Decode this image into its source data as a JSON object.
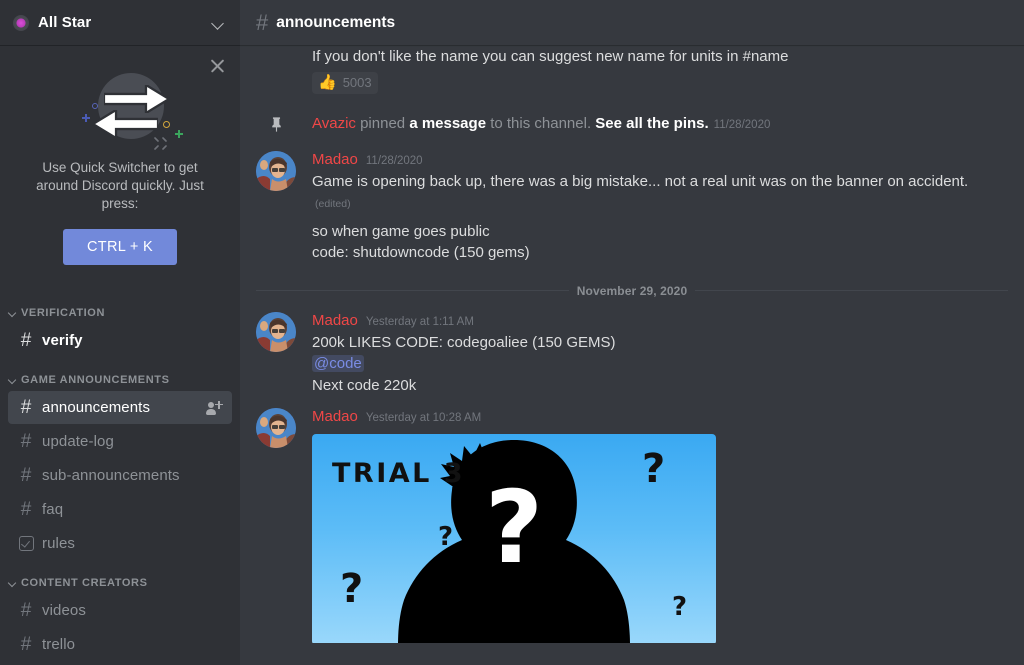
{
  "server": {
    "name": "All Star",
    "icon": "server-badge-icon",
    "dropdown_icon": "chevron-down-icon"
  },
  "promo": {
    "close_icon": "close-icon",
    "art_icon": "quick-switcher-arrows-icon",
    "text": "Use Quick Switcher to get around Discord quickly. Just press:",
    "shortcut_label": "CTRL + K",
    "accent_color": "#7289da"
  },
  "sidebar": {
    "categories": [
      {
        "label": "VERIFICATION",
        "channels": [
          {
            "name": "verify",
            "icon": "hash-icon",
            "state": "unread",
            "trailing_icon": null
          }
        ]
      },
      {
        "label": "GAME ANNOUNCEMENTS",
        "channels": [
          {
            "name": "announcements",
            "icon": "hash-icon",
            "state": "active",
            "trailing_icon": "invite-member-icon"
          },
          {
            "name": "update-log",
            "icon": "hash-icon",
            "state": "default",
            "trailing_icon": null
          },
          {
            "name": "sub-announcements",
            "icon": "hash-icon",
            "state": "default",
            "trailing_icon": null
          },
          {
            "name": "faq",
            "icon": "hash-icon",
            "state": "default",
            "trailing_icon": null
          },
          {
            "name": "rules",
            "icon": "rules-checkbox-icon",
            "state": "default",
            "trailing_icon": null
          }
        ]
      },
      {
        "label": "CONTENT CREATORS",
        "channels": [
          {
            "name": "videos",
            "icon": "hash-icon",
            "state": "default",
            "trailing_icon": null
          },
          {
            "name": "trello",
            "icon": "hash-icon",
            "state": "default",
            "trailing_icon": null
          }
        ]
      }
    ]
  },
  "channel_header": {
    "hash": "#",
    "name": "announcements"
  },
  "messages": {
    "partial_top": {
      "text": "If you don't like the name you can suggest new name for units in #name",
      "reaction": {
        "emoji": "👍",
        "emoji_name": "thumbs-up-emoji",
        "count": "5003"
      }
    },
    "pin_notice": {
      "icon": "pin-icon",
      "author": "Avazic",
      "verb": " pinned ",
      "object": "a message",
      "suffix": " to this channel. ",
      "link": "See all the pins.",
      "timestamp": "11/28/2020"
    },
    "message_1": {
      "author": "Madao",
      "timestamp": "11/28/2020",
      "line_1": "Game is opening back up, there was a big mistake... not a real unit was on the banner on accident.",
      "edited": "(edited)",
      "line_2": "so when game goes public",
      "line_3": "code: shutdowncode (150 gems)"
    },
    "date_divider": "November 29, 2020",
    "message_2": {
      "author": "Madao",
      "timestamp": "Yesterday at 1:11 AM",
      "line_1": "200k LIKES CODE: codegoaliee (150 GEMS)",
      "mention": "@code",
      "line_3": "Next code 220k"
    },
    "message_3": {
      "author": "Madao",
      "timestamp": "Yesterday at 10:28 AM",
      "attachment": {
        "name": "trial-3-image",
        "title_text": "TRIAL 3",
        "alt": "Blue background with black silhouette and white question mark"
      }
    }
  },
  "colors": {
    "author_red": "#f04747",
    "mention_blue": "#7a8ce4",
    "sidebar_bg": "#2f3136",
    "main_bg": "#36393f",
    "active_channel_bg": "#42464d"
  }
}
